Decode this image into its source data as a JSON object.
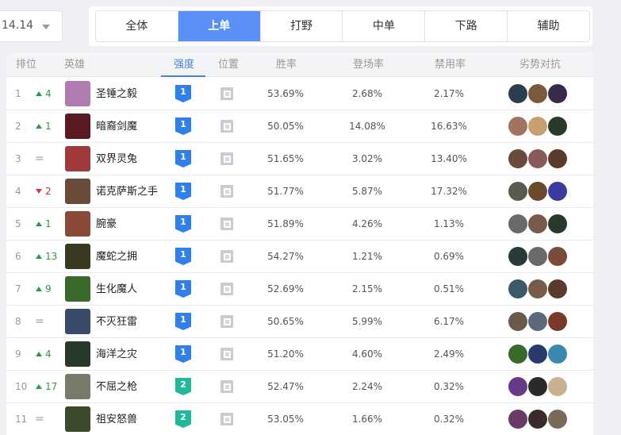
{
  "version": {
    "value": "14.14"
  },
  "tabs": [
    {
      "label": "全体",
      "active": false
    },
    {
      "label": "上单",
      "active": true
    },
    {
      "label": "打野",
      "active": false
    },
    {
      "label": "中单",
      "active": false
    },
    {
      "label": "下路",
      "active": false
    },
    {
      "label": "辅助",
      "active": false
    }
  ],
  "headers": {
    "rank": "排位",
    "hero": "英雄",
    "tier": "强度",
    "position": "位置",
    "win_rate": "胜率",
    "pick_rate": "登场率",
    "ban_rate": "禁用率",
    "counters": "劣势对抗"
  },
  "colors": {
    "accent": "#5a8ff5",
    "up": "#2e9c3c",
    "down": "#d9363e",
    "tier1": "#2f80ed",
    "tier2": "#20b89a"
  },
  "rows": [
    {
      "rank": "1",
      "trend": "up",
      "change": "4",
      "name": "圣锤之毅",
      "tier": "1",
      "win": "53.69%",
      "pick": "2.68%",
      "ban": "2.17%",
      "avatar_color": "#b07bb0",
      "counters": [
        "#2c3e50",
        "#7a5a3a",
        "#3a2a4a"
      ]
    },
    {
      "rank": "2",
      "trend": "up",
      "change": "1",
      "name": "暗裔剑魔",
      "tier": "1",
      "win": "50.05%",
      "pick": "14.08%",
      "ban": "16.63%",
      "avatar_color": "#5a1a22",
      "counters": [
        "#a07560",
        "#c8a070",
        "#2a3a2a"
      ]
    },
    {
      "rank": "3",
      "trend": "same",
      "change": "=",
      "name": "双界灵兔",
      "tier": "1",
      "win": "51.65%",
      "pick": "3.02%",
      "ban": "13.40%",
      "avatar_color": "#a03a3a",
      "counters": [
        "#6a4a3a",
        "#8a5a5a",
        "#5a3a2a"
      ]
    },
    {
      "rank": "4",
      "trend": "down",
      "change": "2",
      "name": "诺克萨斯之手",
      "tier": "1",
      "win": "51.77%",
      "pick": "5.87%",
      "ban": "17.32%",
      "avatar_color": "#6a4a38",
      "counters": [
        "#5a5a50",
        "#6a4a2a",
        "#3a3aa0"
      ]
    },
    {
      "rank": "5",
      "trend": "up",
      "change": "1",
      "name": "腕豪",
      "tier": "1",
      "win": "51.89%",
      "pick": "4.26%",
      "ban": "1.13%",
      "avatar_color": "#8a4a3a",
      "counters": [
        "#6a6a6a",
        "#7a5a4a",
        "#2a3a2a"
      ]
    },
    {
      "rank": "6",
      "trend": "up",
      "change": "13",
      "name": "魔蛇之拥",
      "tier": "1",
      "win": "54.27%",
      "pick": "1.21%",
      "ban": "0.69%",
      "avatar_color": "#3a3a20",
      "counters": [
        "#2a3a3a",
        "#6a6a6a",
        "#7a4a3a"
      ]
    },
    {
      "rank": "7",
      "trend": "up",
      "change": "9",
      "name": "生化魔人",
      "tier": "1",
      "win": "52.69%",
      "pick": "2.15%",
      "ban": "0.51%",
      "avatar_color": "#3a6a2a",
      "counters": [
        "#3a5a6a",
        "#7a5a4a",
        "#5a3a2a"
      ]
    },
    {
      "rank": "8",
      "trend": "same",
      "change": "=",
      "name": "不灭狂雷",
      "tier": "1",
      "win": "50.65%",
      "pick": "5.99%",
      "ban": "6.17%",
      "avatar_color": "#3a4a6a",
      "counters": [
        "#6a5a4a",
        "#5a6a7a",
        "#7a3a2a"
      ]
    },
    {
      "rank": "9",
      "trend": "up",
      "change": "4",
      "name": "海洋之灾",
      "tier": "1",
      "win": "51.20%",
      "pick": "4.60%",
      "ban": "2.49%",
      "avatar_color": "#2a3a2a",
      "counters": [
        "#3a6a2a",
        "#2a3a6a",
        "#3a8ab0"
      ]
    },
    {
      "rank": "10",
      "trend": "up",
      "change": "17",
      "name": "不屈之枪",
      "tier": "2",
      "win": "52.47%",
      "pick": "2.24%",
      "ban": "0.32%",
      "avatar_color": "#7a7a6a",
      "counters": [
        "#6a3a8a",
        "#2a2a2a",
        "#c8b090"
      ]
    },
    {
      "rank": "11",
      "trend": "same",
      "change": "=",
      "name": "祖安怒兽",
      "tier": "2",
      "win": "53.05%",
      "pick": "1.66%",
      "ban": "0.32%",
      "avatar_color": "#3a4a2a",
      "counters": [
        "#6a3a6a",
        "#3a2a2a",
        "#7a6a5a"
      ]
    }
  ]
}
